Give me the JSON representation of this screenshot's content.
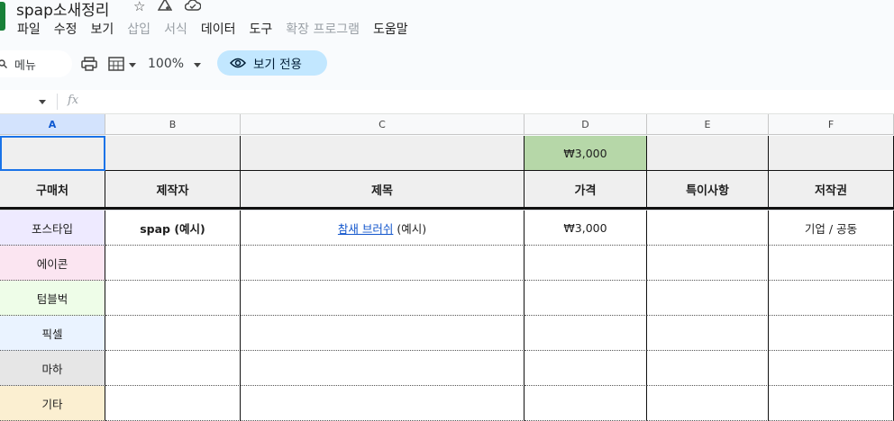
{
  "doc": {
    "title": "spap소새정리"
  },
  "menu": [
    "파일",
    "수정",
    "보기",
    "삽입",
    "서식",
    "데이터",
    "도구",
    "확장 프로그램",
    "도움말"
  ],
  "menu_disabled": [
    false,
    false,
    false,
    true,
    true,
    false,
    false,
    true,
    false
  ],
  "toolbar": {
    "search_label": "메뉴",
    "zoom": "100%",
    "view_only": "보기 전용"
  },
  "formula": {
    "fx": "fx"
  },
  "columns": [
    "A",
    "B",
    "C",
    "D",
    "E",
    "F"
  ],
  "row1": {
    "d": "₩3,000"
  },
  "headers": {
    "a": "구매처",
    "b": "제작자",
    "c": "제목",
    "d": "가격",
    "e": "특이사항",
    "f": "저작권"
  },
  "data_row": {
    "b": "spap (예시)",
    "c_link": "참새 브러쉬",
    "c_rest": " (예시)",
    "d": "₩3,000",
    "f": "기업 / 공동"
  },
  "stores": [
    "포스타입",
    "에이콘",
    "텀블벅",
    "픽셀",
    "마하",
    "기타"
  ],
  "colors": {
    "row1_price": "#b6d7a8",
    "selected_col": "#d3e3fd",
    "view_only_chip": "#c2e7ff",
    "sheets_green": "#188038"
  },
  "store_colors": [
    "#eeeaff",
    "#fbe5f1",
    "#eefde8",
    "#eaf3ff",
    "#e6e6e6",
    "#fbefd1"
  ]
}
